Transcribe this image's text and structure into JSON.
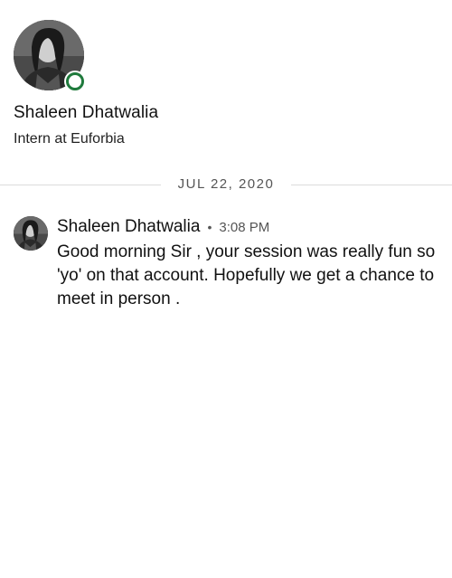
{
  "profile": {
    "name": "Shaleen Dhatwalia",
    "headline": "Intern at Euforbia",
    "status_color": "#1f7a3c"
  },
  "thread": {
    "date_divider": "JUL 22, 2020"
  },
  "message": {
    "sender": "Shaleen Dhatwalia",
    "separator": "•",
    "time": "3:08 PM",
    "text": "Good morning Sir , your session was really fun so 'yo' on that account. Hopefully we get a chance to meet in person ."
  }
}
